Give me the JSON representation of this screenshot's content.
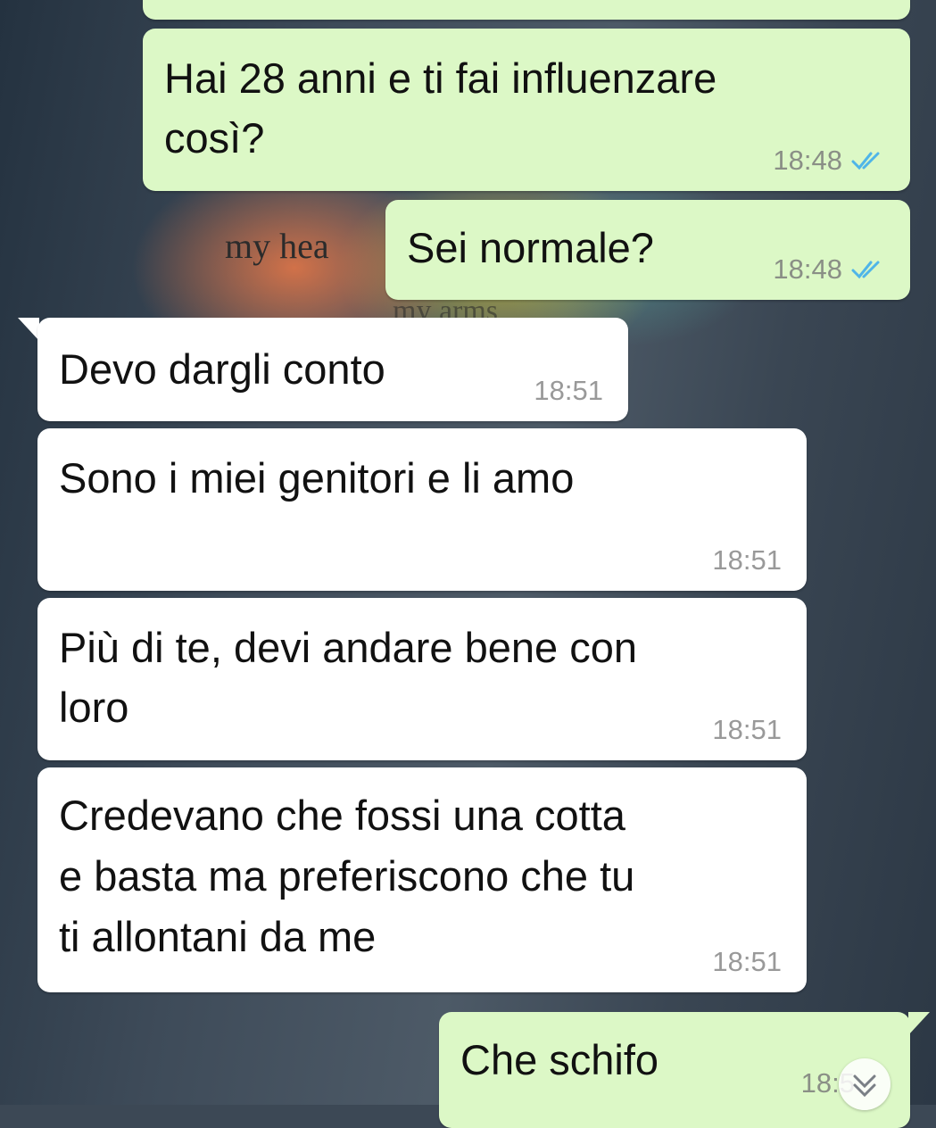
{
  "wallpaper": {
    "text_1": "my hea",
    "text_2": "my arms"
  },
  "messages": [
    {
      "text_line1": "Hai 28 anni e ti fai influenzare",
      "text_line2": "così?",
      "time": "18:48",
      "read_icon": "double-check-icon"
    },
    {
      "text_line1": "Sei normale?",
      "time": "18:48",
      "read_icon": "double-check-icon"
    },
    {
      "text_line1": "Devo dargli conto",
      "time": "18:51"
    },
    {
      "text_line1": "Sono i miei genitori e li amo",
      "time": "18:51"
    },
    {
      "text_line1": "Più di te, devi andare bene con",
      "text_line2": "loro",
      "time": "18:51"
    },
    {
      "text_line1": "Credevano che fossi una cotta",
      "text_line2": "e basta ma preferiscono che tu",
      "text_line3": "ti allontani da me",
      "time": "18:51"
    },
    {
      "text_line1": "Che schifo",
      "time": "18:5",
      "read_icon": "double-check-icon"
    }
  ],
  "scroll_down_icon": "chevron-down-double-icon",
  "colors": {
    "outgoing": "#dcf8c6",
    "incoming": "#ffffff",
    "read_tick": "#4fb5e8"
  }
}
